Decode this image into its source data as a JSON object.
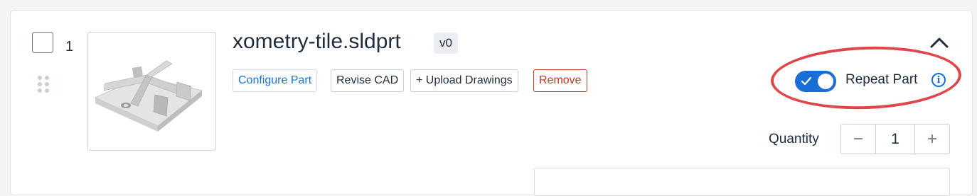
{
  "part": {
    "index": "1",
    "filename": "xometry-tile.sldprt",
    "version": "v0",
    "thumbnail_icon": "part-3d-thumbnail"
  },
  "actions": {
    "configure_label": "Configure Part",
    "revise_label": "Revise CAD",
    "upload_label": "+ Upload Drawings",
    "remove_label": "Remove"
  },
  "repeat": {
    "label": "Repeat Part",
    "enabled": true,
    "info_glyph": "i"
  },
  "quantity": {
    "label": "Quantity",
    "value": "1",
    "decrement_glyph": "−",
    "increment_glyph": "+"
  },
  "colors": {
    "accent": "#1a6ed8",
    "remove": "#c0392b",
    "highlight": "#e0454a"
  }
}
